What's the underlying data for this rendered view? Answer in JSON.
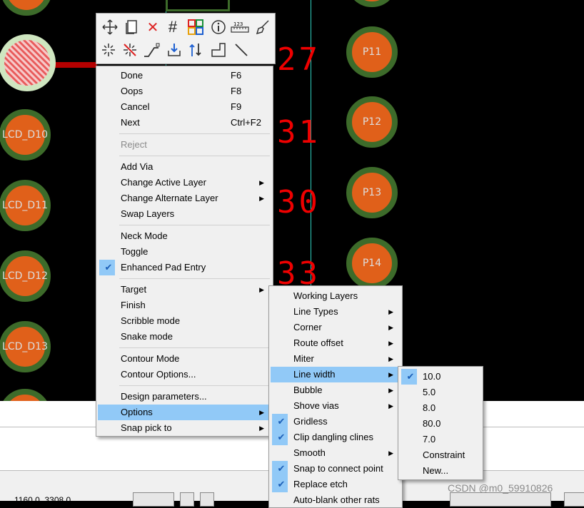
{
  "pads_left": [
    "LCD_D10",
    "LCD_D11",
    "LCD_D12",
    "LCD_D13"
  ],
  "pads_right": [
    "P11",
    "P12",
    "P13",
    "P14"
  ],
  "net_numbers": [
    "27",
    "31",
    "30",
    "33"
  ],
  "toolbar": {
    "row1": [
      "move-icon",
      "copy-icon",
      "delete-icon",
      "grid-icon",
      "color-icon",
      "info-icon",
      "measure-icon",
      "clean-icon"
    ],
    "row2": [
      "spark-icon",
      "no-spark-icon",
      "route-icon",
      "download-icon",
      "swap-icon",
      "step-icon",
      "line-icon"
    ],
    "measure_label": "123"
  },
  "main_menu": {
    "items": [
      {
        "label": "Done",
        "key": "F6"
      },
      {
        "label": "Oops",
        "key": "F8"
      },
      {
        "label": "Cancel",
        "key": "F9"
      },
      {
        "label": "Next",
        "key": "Ctrl+F2"
      },
      {
        "label": "Reject",
        "disabled": true
      },
      {
        "label": "Add Via"
      },
      {
        "label": "Change Active Layer",
        "submenu": true
      },
      {
        "label": "Change Alternate Layer",
        "submenu": true
      },
      {
        "label": "Swap Layers"
      },
      {
        "label": "Neck Mode"
      },
      {
        "label": "Toggle"
      },
      {
        "label": "Enhanced Pad Entry",
        "checked": true
      },
      {
        "label": "Target",
        "submenu": true
      },
      {
        "label": "Finish"
      },
      {
        "label": "Scribble mode"
      },
      {
        "label": "Snake mode"
      },
      {
        "label": "Contour Mode"
      },
      {
        "label": "Contour Options..."
      },
      {
        "label": "Design parameters..."
      },
      {
        "label": "Options",
        "submenu": true,
        "highlighted": true
      },
      {
        "label": "Snap pick to",
        "submenu": true
      }
    ]
  },
  "options_menu": {
    "items": [
      {
        "label": "Working Layers"
      },
      {
        "label": "Line Types",
        "submenu": true
      },
      {
        "label": "Corner",
        "submenu": true
      },
      {
        "label": "Route offset",
        "submenu": true
      },
      {
        "label": "Miter",
        "submenu": true
      },
      {
        "label": "Line width",
        "submenu": true,
        "highlighted": true
      },
      {
        "label": "Bubble",
        "submenu": true
      },
      {
        "label": "Shove vias",
        "submenu": true
      },
      {
        "label": "Gridless",
        "checked": true
      },
      {
        "label": "Clip dangling clines",
        "checked": true
      },
      {
        "label": "Smooth",
        "submenu": true
      },
      {
        "label": "Snap to connect point",
        "checked": true
      },
      {
        "label": "Replace etch",
        "checked": true
      },
      {
        "label": "Auto-blank other rats"
      }
    ]
  },
  "linewidth_menu": {
    "items": [
      {
        "label": "10.0",
        "checked": true
      },
      {
        "label": "5.0"
      },
      {
        "label": "8.0"
      },
      {
        "label": "80.0"
      },
      {
        "label": "7.0"
      },
      {
        "label": "Constraint"
      },
      {
        "label": "New..."
      }
    ]
  },
  "status": {
    "coordinates": "1160.0, 3308.0"
  },
  "watermark": "CSDN @m0_59910826"
}
